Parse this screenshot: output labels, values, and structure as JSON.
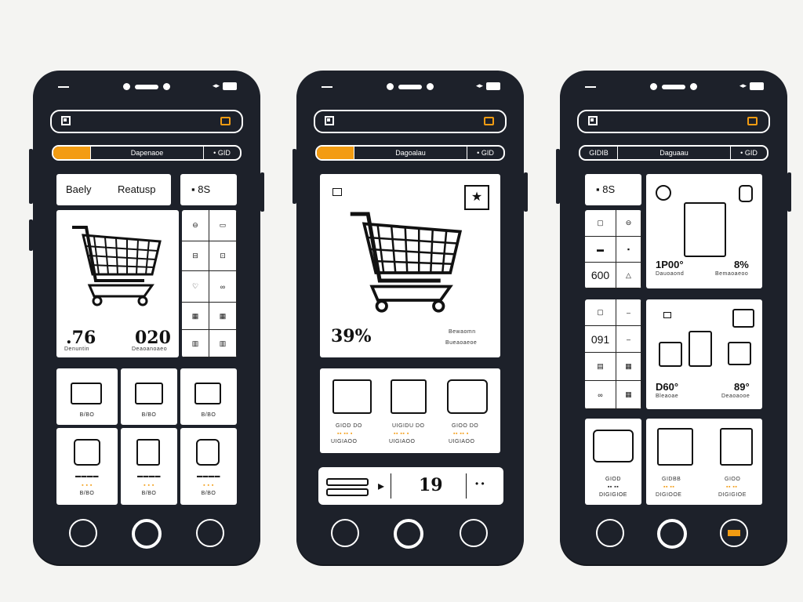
{
  "phones": [
    {
      "tabs": [
        "",
        "Dapenaoe",
        "• GID"
      ],
      "tile_labels": {
        "left": "Baely",
        "right": "Reatusp",
        "corner": "8S"
      },
      "hero": {
        "value_left": ".76",
        "caption_left": "Denuntin",
        "value_right": "020",
        "caption_right": "Deaoanoaeo"
      },
      "grid_item_caption": "B/BO",
      "grid_sub_caption": "B/BO",
      "nav": [
        "cart-nav-icon",
        "home-nav-icon",
        "menu-nav-icon"
      ]
    },
    {
      "tabs": [
        "",
        "Dagoalau",
        "• GID"
      ],
      "hero": {
        "value": "39%",
        "caption_right_1": "Bewaomn",
        "caption_right_2": "Bueaoaeoe"
      },
      "product_captions": [
        "GIOD DO",
        "UIGIDU DO",
        "GIOO DO"
      ],
      "product_sub": [
        "UIGIAOO",
        "UIGIAOO",
        "UIGIAOO"
      ],
      "bottom_bar": {
        "count": "19"
      },
      "nav": [
        "circle-nav-icon",
        "home-nav-icon",
        "globe-nav-icon"
      ]
    },
    {
      "tabs": [
        "GIDIB",
        "Daguaau",
        "• GID"
      ],
      "card_a": {
        "corner": "8S",
        "value_left": "600",
        "value_big": "1P00°",
        "caption_left": "Dauoaond",
        "value_right": "8%",
        "caption_right": "Bemaoaeoo"
      },
      "card_b": {
        "value_left": "091",
        "value_big": "D60°",
        "caption_left": "Bleaoae",
        "value_right": "89°",
        "caption_right": "Deaoaooe"
      },
      "product_captions": [
        "GIOD",
        "GIDBB",
        "GIOO"
      ],
      "product_sub": [
        "DIGIGIOE",
        "DIGIOOE",
        "DIGIGIOE"
      ],
      "nav": [
        "camera-nav-icon",
        "home-nav-icon",
        "card-nav-icon"
      ]
    }
  ],
  "colors": {
    "phone": "#1d212a",
    "accent": "#f39c12",
    "screen": "#ffffff"
  }
}
